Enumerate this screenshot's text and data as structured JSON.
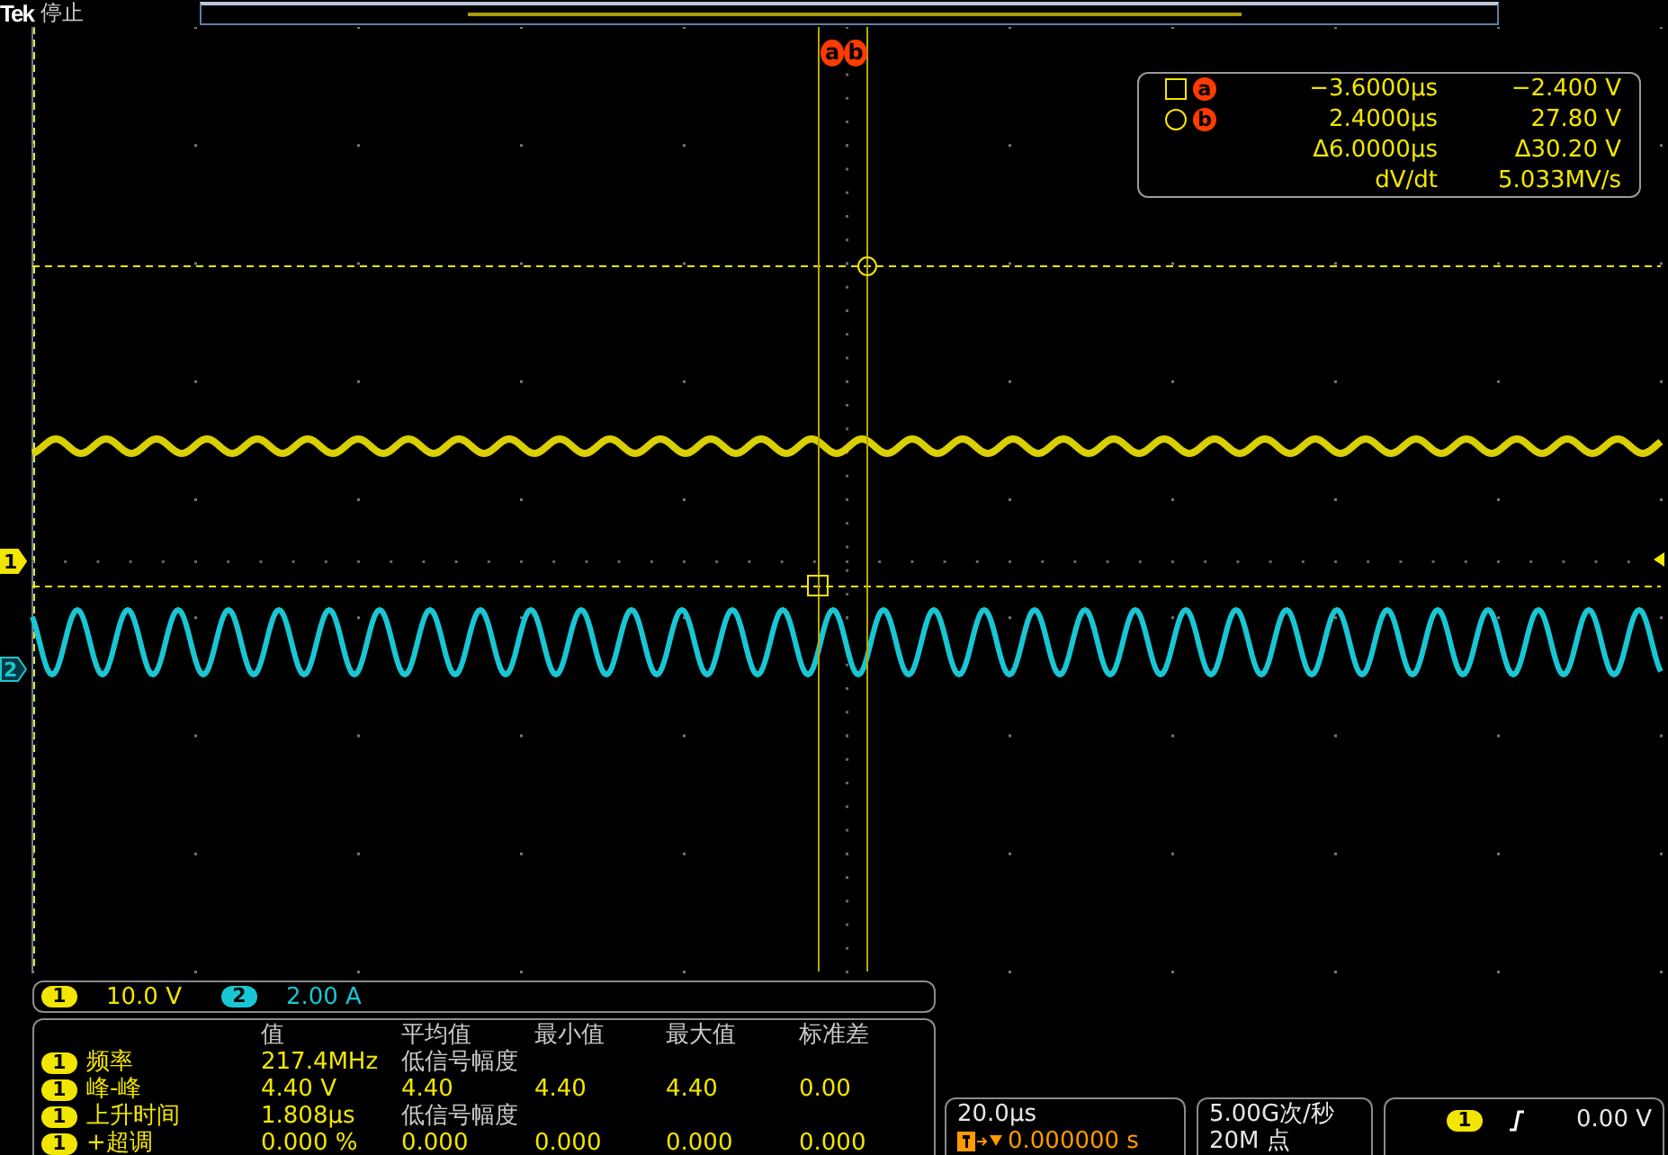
{
  "header": {
    "brand": "Tek",
    "status": "停止"
  },
  "cursor_badges": [
    {
      "label": "a"
    },
    {
      "label": "b"
    }
  ],
  "cursor_readout": [
    {
      "kind": "square",
      "label": "a",
      "time": "−3.6000µs",
      "value": "−2.400 V"
    },
    {
      "kind": "circle",
      "label": "b",
      "time": "2.4000µs",
      "value": "27.80 V"
    },
    {
      "kind": "plain",
      "time": "Δ6.0000µs",
      "value": "Δ30.20 V"
    },
    {
      "kind": "plain",
      "time": "dV/dt",
      "value": "5.033MV/s"
    }
  ],
  "ground_markers": [
    {
      "label": "1",
      "color": "#f2e600"
    },
    {
      "label": "2",
      "color": "#19c6d4"
    }
  ],
  "scale_bar": [
    {
      "channel": "1",
      "value": "10.0 V",
      "color": "#f2e600"
    },
    {
      "channel": "2",
      "value": "2.00 A",
      "color": "#19c6d4"
    }
  ],
  "measurements": {
    "columns": [
      "值",
      "平均值",
      "最小值",
      "最大值",
      "标准差"
    ],
    "rows": [
      {
        "kind": "note",
        "channel": "1",
        "name": "频率",
        "value": "217.4MHz",
        "note": "低信号幅度"
      },
      {
        "kind": "stats",
        "channel": "1",
        "name": "峰-峰",
        "value": "4.40 V",
        "stats": [
          "4.40",
          "4.40",
          "4.40",
          "0.00"
        ]
      },
      {
        "kind": "note",
        "channel": "1",
        "name": "上升时间",
        "value": "1.808µs",
        "note": "低信号幅度"
      },
      {
        "kind": "stats",
        "channel": "1",
        "name": "+超调",
        "value": "0.000 %",
        "stats": [
          "0.000",
          "0.000",
          "0.000",
          "0.000"
        ]
      }
    ]
  },
  "timebase": {
    "scale": "20.0µs",
    "trigger_position": "0.000000 s"
  },
  "acquisition": {
    "rate": "5.00G次/秒",
    "points": "20M 点"
  },
  "trigger": {
    "channel": "1",
    "kind": "rising",
    "level": "0.00 V"
  }
}
